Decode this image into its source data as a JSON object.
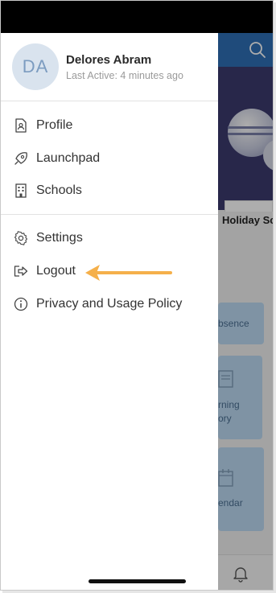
{
  "profile": {
    "initials": "DA",
    "name": "Delores Abram",
    "last_active": "Last Active: 4 minutes ago"
  },
  "menu": {
    "primary": [
      {
        "label": "Profile",
        "icon": "profile-document-icon"
      },
      {
        "label": "Launchpad",
        "icon": "rocket-icon"
      },
      {
        "label": "Schools",
        "icon": "building-icon"
      }
    ],
    "secondary": [
      {
        "label": "Settings",
        "icon": "gear-icon"
      },
      {
        "label": "Logout",
        "icon": "logout-icon"
      },
      {
        "label": "Privacy and Usage Policy",
        "icon": "info-icon"
      }
    ]
  },
  "background_app": {
    "hero_caption": "Holiday Sc",
    "tiles": [
      "bsence",
      "rning\nory",
      "endar"
    ]
  },
  "annotation": {
    "arrow_color": "#f5b04a",
    "points_to": "Logout"
  },
  "colors": {
    "header_blue": "#2f6fb6",
    "tile_blue": "#bcd9f2",
    "avatar_bg": "#d9e3ee"
  }
}
